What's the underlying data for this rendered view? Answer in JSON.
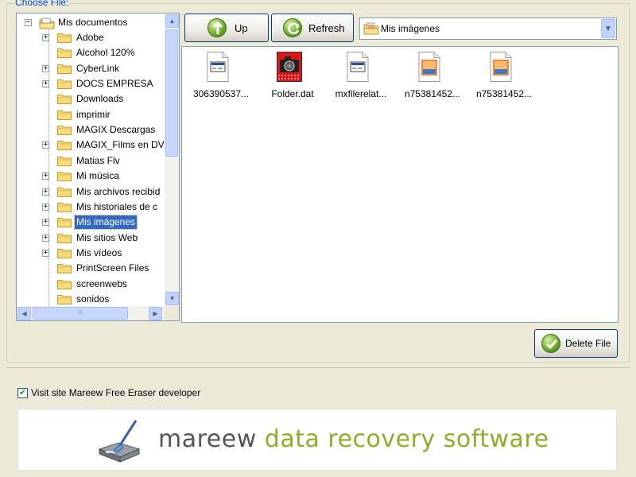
{
  "section_label": "Choose File:",
  "tree": {
    "root_label": "Mis documentos",
    "items": [
      {
        "label": "Adobe",
        "expandable": true
      },
      {
        "label": "Alcohol 120%",
        "expandable": false
      },
      {
        "label": "CyberLink",
        "expandable": true
      },
      {
        "label": "DOCS EMPRESA",
        "expandable": true
      },
      {
        "label": "Downloads",
        "expandable": false
      },
      {
        "label": "imprimir",
        "expandable": false
      },
      {
        "label": "MAGIX Descargas",
        "expandable": false
      },
      {
        "label": "MAGIX_Films en DV",
        "expandable": true
      },
      {
        "label": "Matias Flv",
        "expandable": false
      },
      {
        "label": "Mi música",
        "expandable": true
      },
      {
        "label": "Mis archivos recibid",
        "expandable": true
      },
      {
        "label": "Mis historiales de c",
        "expandable": true
      },
      {
        "label": "Mis imágenes",
        "expandable": true,
        "selected": true
      },
      {
        "label": "Mis sitios Web",
        "expandable": true
      },
      {
        "label": "Mis vídeos",
        "expandable": true
      },
      {
        "label": "PrintScreen Files",
        "expandable": false
      },
      {
        "label": "screenwebs",
        "expandable": false
      },
      {
        "label": "sonidos",
        "expandable": false
      }
    ],
    "hscroll_grip": "III"
  },
  "toolbar": {
    "up_label": "Up",
    "refresh_label": "Refresh",
    "folder_combo_value": "Mis imágenes"
  },
  "files": [
    {
      "name": "306390537...",
      "icon": "generic-file-icon"
    },
    {
      "name": "Folder.dat",
      "icon": "camera-file-icon"
    },
    {
      "name": "mxfilerelat...",
      "icon": "generic-file-icon"
    },
    {
      "name": "n75381452...",
      "icon": "image-file-icon"
    },
    {
      "name": "n75381452...",
      "icon": "image-file-icon"
    }
  ],
  "delete_label": "Delete File",
  "visit_checkbox": {
    "label": "Visit site Mareew Free Eraser developer",
    "checked": true
  },
  "banner": {
    "word1": "mareew",
    "word2": "data recovery software"
  },
  "colors": {
    "window_bg": "#ece9d8",
    "group_label": "#0046d5",
    "selection": "#316ac5",
    "brand_gray": "#555555",
    "brand_green": "#8cae2a"
  }
}
